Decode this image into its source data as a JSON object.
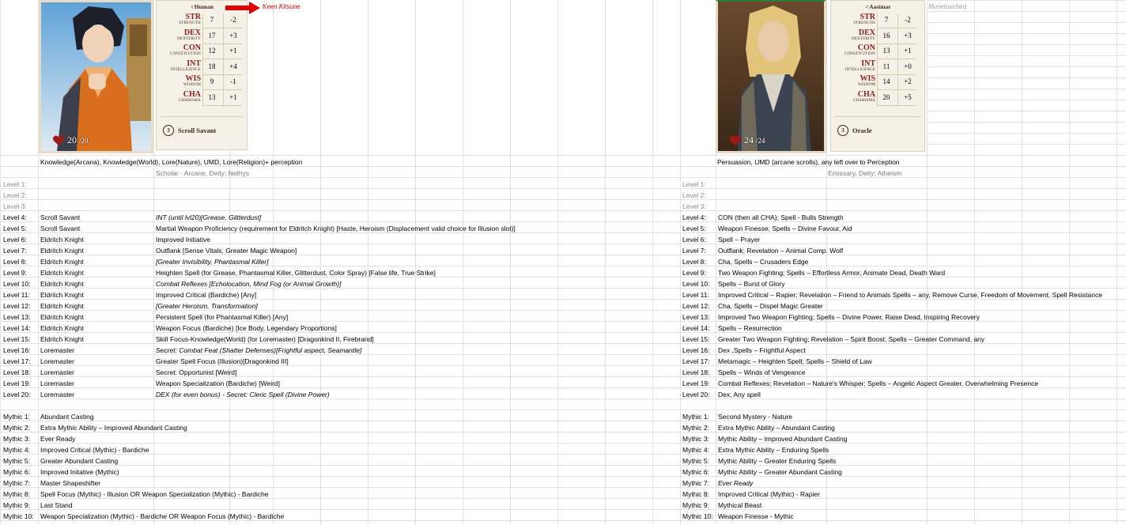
{
  "left": {
    "race": "Human",
    "note": "Keen Kitsune",
    "hp": "20",
    "hp_max": "/20",
    "class_num": "3",
    "class_name": "Scroll Savant",
    "stats": [
      {
        "name": "STR",
        "sub": "STRENGTH",
        "val": "7",
        "mod": "-2"
      },
      {
        "name": "DEX",
        "sub": "DEXTERITY",
        "val": "17",
        "mod": "+3"
      },
      {
        "name": "CON",
        "sub": "CONSTITUTION",
        "val": "12",
        "mod": "+1"
      },
      {
        "name": "INT",
        "sub": "INTELLIGENCE",
        "val": "18",
        "mod": "+4"
      },
      {
        "name": "WIS",
        "sub": "WISDOM",
        "val": "9",
        "mod": "-1"
      },
      {
        "name": "CHA",
        "sub": "CHARISMA",
        "val": "13",
        "mod": "+1"
      }
    ],
    "skills": "Knowledge(Arcana), Knowledge(World), Lore(Nature), UMD, Lore(Religion)+ perception",
    "background": "Scholar - Arcane, Deity: Nethys",
    "levels": [
      {
        "label": "Level 1:",
        "cls": "",
        "desc": ""
      },
      {
        "label": "Level 2:",
        "cls": "",
        "desc": ""
      },
      {
        "label": "Level 3:",
        "cls": "",
        "desc": ""
      },
      {
        "label": "Level 4:",
        "cls": "Scroll Savant",
        "desc": "INT (until lvl20)[Grease, Glitterdust]"
      },
      {
        "label": "Level 5:",
        "cls": "Scroll Savant",
        "desc": "Martial Weapon Proficiency (requirement for Eldritch Knight) [Haste, Heroism (Displacement valid choice for Illusion slot)]"
      },
      {
        "label": "Level 6:",
        "cls": "Eldritch Knight",
        "desc": "Improved Initiative"
      },
      {
        "label": "Level 7:",
        "cls": "Eldritch Knight",
        "desc": "Outflank [Sense Vitals, Greater Magic Weapon]"
      },
      {
        "label": "Level 8:",
        "cls": "Eldritch Knight",
        "desc": "[Greater Invisibility, Phantasmal Killer]"
      },
      {
        "label": "Level 9:",
        "cls": "Eldritch Knight",
        "desc": "Heighten Spell (for Grease, Phantasmal Killer, Glitterdust, Color Spray) [False life, True Strike]"
      },
      {
        "label": "Level 10:",
        "cls": "Eldritch Knight",
        "desc": "Combat Reflexes [Echolocation, Mind Fog (or Animal Growth)]"
      },
      {
        "label": "Level 11:",
        "cls": "Eldritch Knight",
        "desc": "Improved Critical (Bardiche) [Any]"
      },
      {
        "label": "Level 12:",
        "cls": "Eldritch Knight",
        "desc": "[Greater Heroism, Transformation]"
      },
      {
        "label": "Level 13:",
        "cls": "Eldritch Knight",
        "desc": "Persistent Spell (for Phantasmal Killer) [Any]"
      },
      {
        "label": "Level 14:",
        "cls": "Eldritch Knight",
        "desc": "Weapon Focus (Bardiche) [Ice Body, Legendary Proportions]"
      },
      {
        "label": "Level 15:",
        "cls": "Eldritch Knight",
        "desc": "Skill Focus-Knowledge(World) (for Loremaster) [Dragonkind II, Firebrand]"
      },
      {
        "label": "Level 16:",
        "cls": "Loremaster",
        "desc": "Secret: Combat Feat (Shatter Defenses)[Frightful aspect, Seamantle]"
      },
      {
        "label": "Level 17:",
        "cls": "Loremaster",
        "desc": "Greater Spell Focus (Illusion)[Dragonkind III]"
      },
      {
        "label": "Level 18:",
        "cls": "Loremaster",
        "desc": "Secret: Opportunist [Weird]"
      },
      {
        "label": "Level 19:",
        "cls": "Loremaster",
        "desc": "Weapon Specialization (Bardiche) [Weird]"
      },
      {
        "label": "Level 20:",
        "cls": "Loremaster",
        "desc": "DEX (for even bonus) - Secret: Cleric Spell (Divine Power)"
      }
    ],
    "mythic": [
      {
        "label": "Mythic 1:",
        "desc": "Abundant Casting"
      },
      {
        "label": "Mythic 2:",
        "desc": "Extra Mythic Ability – Improved Abundant Casting"
      },
      {
        "label": "Mythic 3:",
        "desc": "Ever Ready"
      },
      {
        "label": "Mythic 4:",
        "desc": "Improved Critical (Mythic) - Bardiche"
      },
      {
        "label": "Mythic 5:",
        "desc": "Greater Abundant Casting"
      },
      {
        "label": "Mythic 6:",
        "desc": "Improved Initative (Mythic)"
      },
      {
        "label": "Mythic 7:",
        "desc": "Master Shapeshifter"
      },
      {
        "label": "Mythic 8:",
        "desc": "Spell Focus (Mythic) - Illusion OR Weapon Specialization (Mythic) - Bardiche"
      },
      {
        "label": "Mythic 9:",
        "desc": "Last Stand"
      },
      {
        "label": "Mythic 10:",
        "desc": "Weapon Specialization (Mythic) - Bardiche OR Weapon Focus (Mythic) - Bardiche"
      }
    ]
  },
  "right": {
    "race": "Aasimar",
    "note": "Musetouched",
    "hp": "24",
    "hp_max": "/24",
    "class_num": "3",
    "class_name": "Oracle",
    "stats": [
      {
        "name": "STR",
        "sub": "STRENGTH",
        "val": "7",
        "mod": "-2"
      },
      {
        "name": "DEX",
        "sub": "DEXTERITY",
        "val": "16",
        "mod": "+3"
      },
      {
        "name": "CON",
        "sub": "CONSTITUTION",
        "val": "13",
        "mod": "+1"
      },
      {
        "name": "INT",
        "sub": "INTELLIGENCE",
        "val": "11",
        "mod": "+0"
      },
      {
        "name": "WIS",
        "sub": "WISDOM",
        "val": "14",
        "mod": "+2"
      },
      {
        "name": "CHA",
        "sub": "CHARISMA",
        "val": "20",
        "mod": "+5"
      }
    ],
    "skills": "Persuasion, UMD (arcane scrolls), any left over to Perception",
    "background": "Emissary, Deity: Atheism",
    "levels": [
      {
        "label": "Level 1:",
        "desc": ""
      },
      {
        "label": "Level 2:",
        "desc": ""
      },
      {
        "label": "Level 3:",
        "desc": ""
      },
      {
        "label": "Level 4:",
        "desc": "CON (then all CHA); Spell - Bulls Strength"
      },
      {
        "label": "Level 5:",
        "desc": "Weapon Finesse; Spells – Divine Favour, Aid"
      },
      {
        "label": "Level 6:",
        "desc": "Spell – Prayer"
      },
      {
        "label": "Level 7:",
        "desc": "Outflank; Revelation – Animal Comp. Wolf"
      },
      {
        "label": "Level 8:",
        "desc": "Cha, Spells – Crusaders Edge"
      },
      {
        "label": "Level 9:",
        "desc": "Two Weapon Fighting; Spells – Effortless Armor, Animate Dead, Death Ward"
      },
      {
        "label": "Level 10:",
        "desc": "Spells – Burst of Glory"
      },
      {
        "label": "Level 11:",
        "desc": "Improved Critical – Rapier; Revelation – Friend to Animals Spells – any, Remove Curse, Freedom of Movement, Spell Resistance"
      },
      {
        "label": "Level 12:",
        "desc": "Cha, Spells – Dispel Magic Greater"
      },
      {
        "label": "Level 13:",
        "desc": "Improved Two Weapon Fighting; Spells – Divine Power, Raise Dead, Inspiring Recovery"
      },
      {
        "label": "Level 14:",
        "desc": "Spells – Resurrection"
      },
      {
        "label": "Level 15:",
        "desc": "Greater Two Weapon Fighting; Revelation – Spirit Boost; Spells – Greater Command, any"
      },
      {
        "label": "Level 16:",
        "desc": "Dex ,Spells – Frightful Aspect"
      },
      {
        "label": "Level 17:",
        "desc": "Metamagic – Heighten Spell; Spells – Shield of Law"
      },
      {
        "label": "Level 18:",
        "desc": "Spells – Winds of Vengeance"
      },
      {
        "label": "Level 19:",
        "desc": "Combat Reflexes; Revelation – Nature's Whisper; Spells – Angelic Aspect Greater, Overwhelming Presence"
      },
      {
        "label": "Level 20:",
        "desc": "Dex, Any spell"
      }
    ],
    "mythic": [
      {
        "label": "Mythic 1:",
        "desc": "Second Mystery - Nature"
      },
      {
        "label": "Mythic 2:",
        "desc": "Extra Mythic Ability – Abundant Casting"
      },
      {
        "label": "Mythic 3:",
        "desc": "Mythic Ability – Improved Abundant Casting"
      },
      {
        "label": "Mythic 4:",
        "desc": "Extra Mythic Ability – Enduring Spells"
      },
      {
        "label": "Mythic 5:",
        "desc": "Mythic Ability – Greater Enduring Spells"
      },
      {
        "label": "Mythic 6:",
        "desc": "Mythic Ability – Greater Abundant Casting"
      },
      {
        "label": "Mythic 7:",
        "desc": "Ever Ready"
      },
      {
        "label": "Mythic 8:",
        "desc": "Improved Critical (Mythic) - Rapier"
      },
      {
        "label": "Mythic 9:",
        "desc": "Mythical Beast"
      },
      {
        "label": "Mythic 10:",
        "desc": "Weapon Finesse - Mythic"
      }
    ]
  },
  "colors": {
    "note_left": "#cc0000",
    "note_right": "#a0a0a0",
    "stat_red": "#8a1c1c",
    "arrow": "#e00000"
  }
}
